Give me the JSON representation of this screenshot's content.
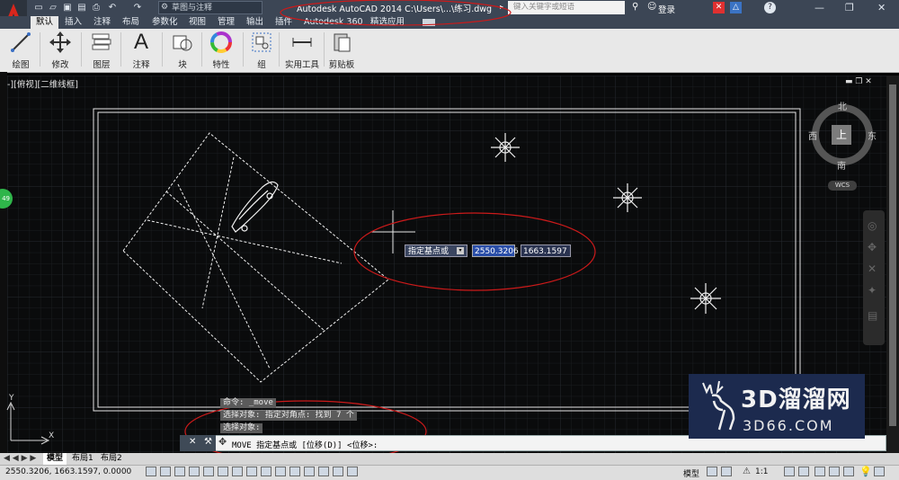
{
  "title_bar": {
    "workspace": "草图与注释",
    "app_title": "Autodesk AutoCAD 2014    C:\\Users\\...\\练习.dwg",
    "search_placeholder": "键入关键字或短语",
    "login": "登录"
  },
  "tabs": [
    "默认",
    "插入",
    "注释",
    "布局",
    "参数化",
    "视图",
    "管理",
    "输出",
    "插件",
    "Autodesk 360",
    "精选应用"
  ],
  "ribbon_buttons": [
    {
      "label": "绘图",
      "icon": "line-draw-icon"
    },
    {
      "label": "修改",
      "icon": "move-arrows-icon"
    },
    {
      "label": "图层",
      "icon": "layers-icon"
    },
    {
      "label": "注释",
      "icon": "text-a-icon"
    },
    {
      "label": "块",
      "icon": "block-icon"
    },
    {
      "label": "特性",
      "icon": "color-wheel-icon"
    },
    {
      "label": "组",
      "icon": "group-icon"
    },
    {
      "label": "实用工具",
      "icon": "measure-icon"
    },
    {
      "label": "剪贴板",
      "icon": "clipboard-icon"
    }
  ],
  "viewport_label": "-][俯视][二维线框]",
  "viewcube": {
    "north": "北",
    "south": "南",
    "east": "东",
    "west": "西",
    "top": "上",
    "wcs": "WCS"
  },
  "dynamic_input": {
    "prompt": "指定基点或",
    "x": "2550.3206",
    "y": "1663.1597"
  },
  "command_history": [
    "命令: _move",
    "选择对象: 指定对角点: 找到 7 个",
    "选择对象:"
  ],
  "command_line": "MOVE 指定基点或 [位移(D)] <位移>:",
  "layout_tabs": [
    "模型",
    "布局1",
    "布局2"
  ],
  "status": {
    "coords": "2550.3206, 1663.1597, 0.0000",
    "model": "模型",
    "scale": "1:1"
  },
  "badge": "49",
  "watermark": {
    "big": "3D溜溜网",
    "small": "3D66.COM"
  },
  "colors": {
    "titlebar": "#3c4655",
    "ribbon": "#e8e8e8",
    "canvas": "#0a0b0c",
    "annotation": "#cc1a1a",
    "watermark": "#1c2a4e"
  }
}
